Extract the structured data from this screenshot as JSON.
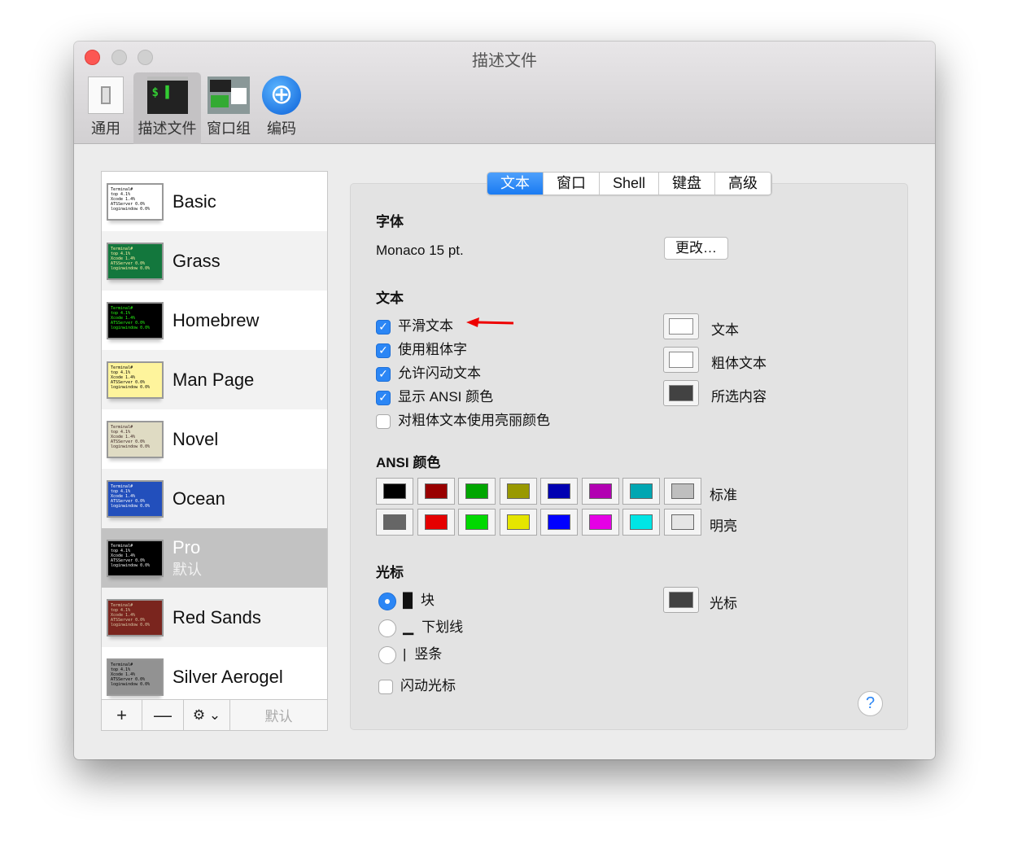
{
  "window": {
    "title": "描述文件"
  },
  "toolbar": [
    {
      "label": "通用",
      "icon": "switch-icon"
    },
    {
      "label": "描述文件",
      "icon": "terminal-icon"
    },
    {
      "label": "窗口组",
      "icon": "window-group-icon"
    },
    {
      "label": "编码",
      "icon": "globe-icon"
    }
  ],
  "profiles": [
    {
      "name": "Basic",
      "bg": "#ffffff",
      "fg": "#000000"
    },
    {
      "name": "Grass",
      "bg": "#13773d",
      "fg": "#fff0a5"
    },
    {
      "name": "Homebrew",
      "bg": "#000000",
      "fg": "#28fe14"
    },
    {
      "name": "Man Page",
      "bg": "#fef49c",
      "fg": "#000000"
    },
    {
      "name": "Novel",
      "bg": "#dfdbc3",
      "fg": "#3b2322"
    },
    {
      "name": "Ocean",
      "bg": "#224fbc",
      "fg": "#ffffff"
    },
    {
      "name": "Pro",
      "sub": "默认",
      "bg": "#000000",
      "fg": "#f2f2f2",
      "selected": true
    },
    {
      "name": "Red Sands",
      "bg": "#7a251e",
      "fg": "#d7c9a7"
    },
    {
      "name": "Silver Aerogel",
      "bg": "#929292",
      "fg": "#000000"
    }
  ],
  "thumb_text": [
    "Terminal#",
    "top   4.1%",
    "Xcode 1.4%",
    "ATSServer 0.0%",
    "loginwindow 0.0%"
  ],
  "list_buttons": {
    "add": "+",
    "remove": "—",
    "gear": "⚙ ⌄",
    "default": "默认"
  },
  "tabs": [
    {
      "label": "文本",
      "active": true
    },
    {
      "label": "窗口"
    },
    {
      "label": "Shell"
    },
    {
      "label": "键盘"
    },
    {
      "label": "高级"
    }
  ],
  "font": {
    "heading": "字体",
    "value": "Monaco 15 pt.",
    "change_button": "更改…"
  },
  "text": {
    "heading": "文本",
    "options": [
      {
        "label": "平滑文本",
        "checked": true
      },
      {
        "label": "使用粗体字",
        "checked": true
      },
      {
        "label": "允许闪动文本",
        "checked": true
      },
      {
        "label": "显示 ANSI 颜色",
        "checked": true
      },
      {
        "label": "对粗体文本使用亮丽颜色",
        "checked": false
      }
    ],
    "colors": [
      {
        "label": "文本",
        "color": "#ffffff"
      },
      {
        "label": "粗体文本",
        "color": "#ffffff"
      },
      {
        "label": "所选内容",
        "color": "#424242"
      }
    ]
  },
  "ansi": {
    "heading": "ANSI 颜色",
    "normal_label": "标准",
    "bright_label": "明亮",
    "normal": [
      "#000000",
      "#990000",
      "#00a600",
      "#999900",
      "#0000b2",
      "#b200b2",
      "#00a6b2",
      "#bfbfbf"
    ],
    "bright": [
      "#666666",
      "#e50000",
      "#00d900",
      "#e5e500",
      "#0000ff",
      "#e500e5",
      "#00e5e5",
      "#e5e5e5"
    ]
  },
  "cursor": {
    "heading": "光标",
    "styles": [
      {
        "label": "块",
        "glyph": "█",
        "selected": true
      },
      {
        "label": "下划线",
        "glyph": "▁"
      },
      {
        "label": "竖条",
        "glyph": "|"
      }
    ],
    "blink_label": "闪动光标",
    "blink": false,
    "color_label": "光标",
    "color": "#424242"
  },
  "help": "?"
}
